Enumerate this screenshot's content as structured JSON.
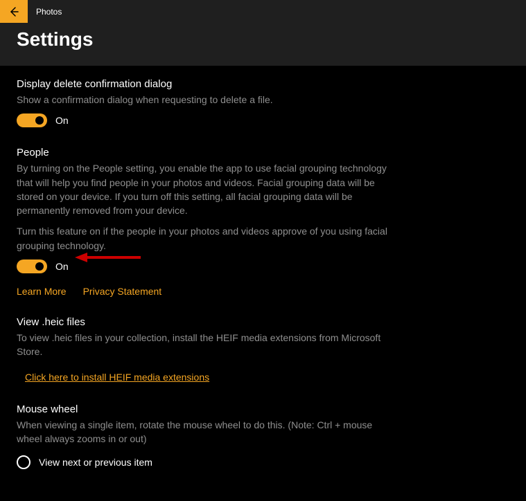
{
  "app": {
    "title": "Photos"
  },
  "page": {
    "title": "Settings"
  },
  "colors": {
    "accent": "#f5a623"
  },
  "sections": {
    "delete": {
      "title": "Display delete confirmation dialog",
      "desc": "Show a confirmation dialog when requesting to delete a file.",
      "toggle_state": "On"
    },
    "people": {
      "title": "People",
      "desc": "By turning on the People setting, you enable the app to use facial grouping technology that will help you find people in your photos and videos. Facial grouping data will be stored on your device. If you turn off this setting, all facial grouping data will be permanently removed from your device.",
      "desc2": "Turn this feature on if the people in your photos and videos approve of you using facial grouping technology.",
      "toggle_state": "On",
      "link_learn": "Learn More",
      "link_privacy": "Privacy Statement"
    },
    "heic": {
      "title": "View .heic files",
      "desc": "To view .heic files in your collection, install the HEIF media extensions from Microsoft Store.",
      "link": "Click here to install HEIF media extensions"
    },
    "mouse": {
      "title": "Mouse wheel",
      "desc": "When viewing a single item, rotate the mouse wheel to do this. (Note: Ctrl + mouse wheel always zooms in or out)",
      "option1": "View next or previous item"
    }
  }
}
